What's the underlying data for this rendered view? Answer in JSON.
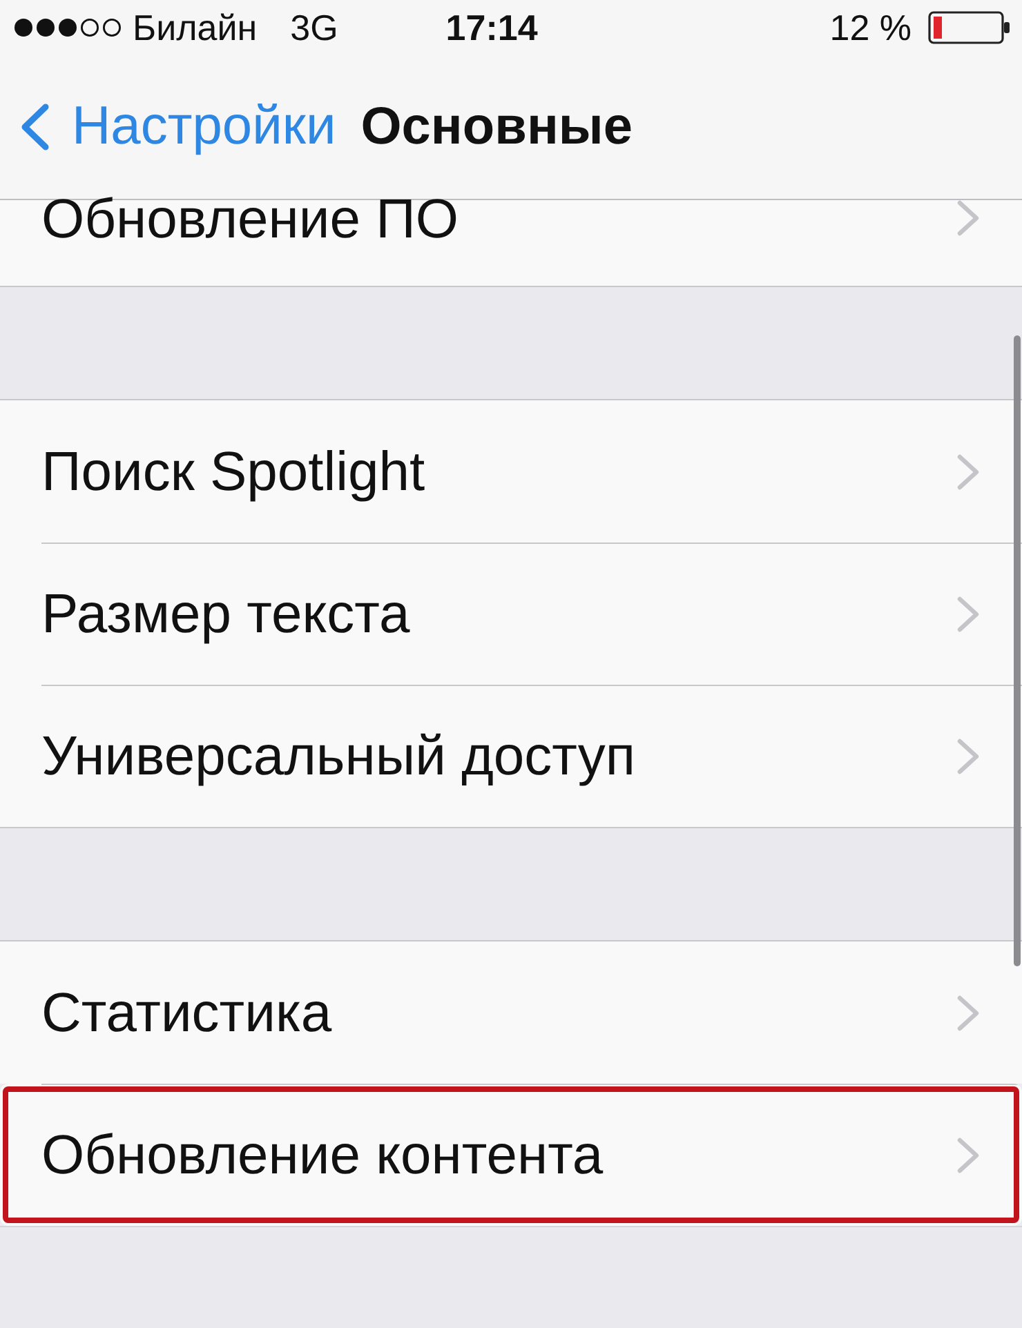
{
  "status_bar": {
    "carrier": "Билайн",
    "network": "3G",
    "time": "17:14",
    "battery": "12 %"
  },
  "nav_bar": {
    "back_label": "Настройки",
    "title": "Основные"
  },
  "sections": [
    {
      "items": [
        {
          "label": "Обновление ПО",
          "highlighted": false
        }
      ]
    },
    {
      "items": [
        {
          "label": "Поиск Spotlight",
          "highlighted": false
        },
        {
          "label": "Размер текста",
          "highlighted": false
        },
        {
          "label": "Универсальный доступ",
          "highlighted": false
        }
      ]
    },
    {
      "items": [
        {
          "label": "Статистика",
          "highlighted": false
        },
        {
          "label": "Обновление контента",
          "highlighted": true
        }
      ]
    }
  ]
}
